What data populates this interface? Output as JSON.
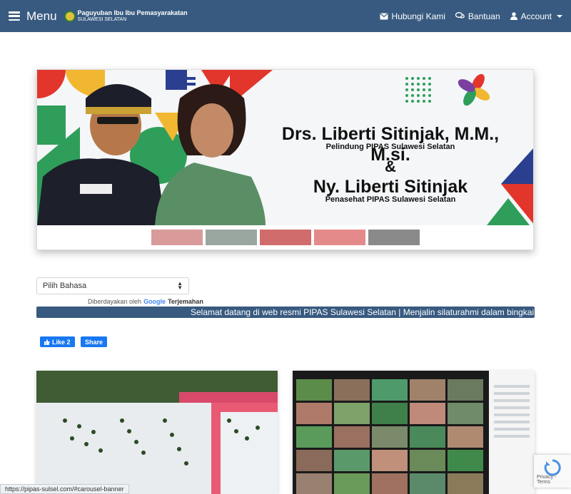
{
  "navbar": {
    "menu_label": "Menu",
    "brand_title": "Paguyuban Ibu Ibu Pemasyarakatan",
    "brand_sub": "SULAWESI SELATAN",
    "links": [
      {
        "label": "Hubungi Kami",
        "icon": "envelope-icon"
      },
      {
        "label": "Bantuan",
        "icon": "chat-bubbles-icon"
      },
      {
        "label": "Account",
        "icon": "user-icon"
      }
    ]
  },
  "banner": {
    "line1": "Drs. Liberti Sitinjak, M.M., M.si.",
    "line2": "Pelindung PIPAS Sulawesi Selatan",
    "line3": "&",
    "line4": "Ny. Liberti Sitinjak",
    "line5": "Penasehat PIPAS Sulawesi Selatan",
    "thumbnails": 5
  },
  "translate": {
    "select_value": "Pilih Bahasa",
    "powered_by": "Diberdayakan oleh",
    "google": "Google",
    "translate_label": "Terjemahan"
  },
  "marquee": {
    "text": "Selamat datang di web resmi PIPAS Sulawesi Selatan | Menjalin silaturahmi dalam bingkai kebers"
  },
  "social": {
    "like_label": "Like 2",
    "share_label": "Share"
  },
  "status_bar": {
    "url": "https://pipas-sulsel.com/#carousel-banner"
  },
  "recaptcha": {
    "text": "Privacy - Terms"
  },
  "colors": {
    "navbar": "#385a80",
    "facebook": "#1877f2",
    "marquee": "#385a80"
  }
}
